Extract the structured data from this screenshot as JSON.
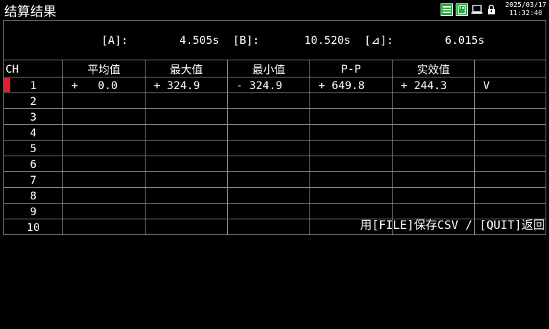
{
  "app": {
    "title": "结算结果"
  },
  "status": {
    "icons": [
      "list-icon",
      "memory-card-icon",
      "pc-icon",
      "lock-icon"
    ],
    "date": "2025/03/17",
    "time": "11:32:40"
  },
  "cursors": {
    "a_label": "[A]:",
    "a_value": "4.505s",
    "b_label": "[B]:",
    "b_value": "10.520s",
    "d_label": "[⊿]:",
    "d_value": "6.015s"
  },
  "table": {
    "headers": [
      "CH",
      "平均值",
      "最大值",
      "最小值",
      "P-P",
      "实效值",
      ""
    ],
    "rows": [
      {
        "ch": "1",
        "avg": "+   0.0",
        "max": "+ 324.9",
        "min": "- 324.9",
        "pp": "+ 649.8",
        "rms": "+ 244.3",
        "unit": "V"
      },
      {
        "ch": "2",
        "avg": "",
        "max": "",
        "min": "",
        "pp": "",
        "rms": "",
        "unit": ""
      },
      {
        "ch": "3",
        "avg": "",
        "max": "",
        "min": "",
        "pp": "",
        "rms": "",
        "unit": ""
      },
      {
        "ch": "4",
        "avg": "",
        "max": "",
        "min": "",
        "pp": "",
        "rms": "",
        "unit": ""
      },
      {
        "ch": "5",
        "avg": "",
        "max": "",
        "min": "",
        "pp": "",
        "rms": "",
        "unit": ""
      },
      {
        "ch": "6",
        "avg": "",
        "max": "",
        "min": "",
        "pp": "",
        "rms": "",
        "unit": ""
      },
      {
        "ch": "7",
        "avg": "",
        "max": "",
        "min": "",
        "pp": "",
        "rms": "",
        "unit": ""
      },
      {
        "ch": "8",
        "avg": "",
        "max": "",
        "min": "",
        "pp": "",
        "rms": "",
        "unit": ""
      },
      {
        "ch": "9",
        "avg": "",
        "max": "",
        "min": "",
        "pp": "",
        "rms": "",
        "unit": ""
      },
      {
        "ch": "10",
        "avg": "",
        "max": "",
        "min": "",
        "pp": "",
        "rms": "",
        "unit": ""
      }
    ],
    "selected_marker_color": "#e0202a"
  },
  "footer": {
    "hint": "用[FILE]保存CSV / [QUIT]返回"
  }
}
